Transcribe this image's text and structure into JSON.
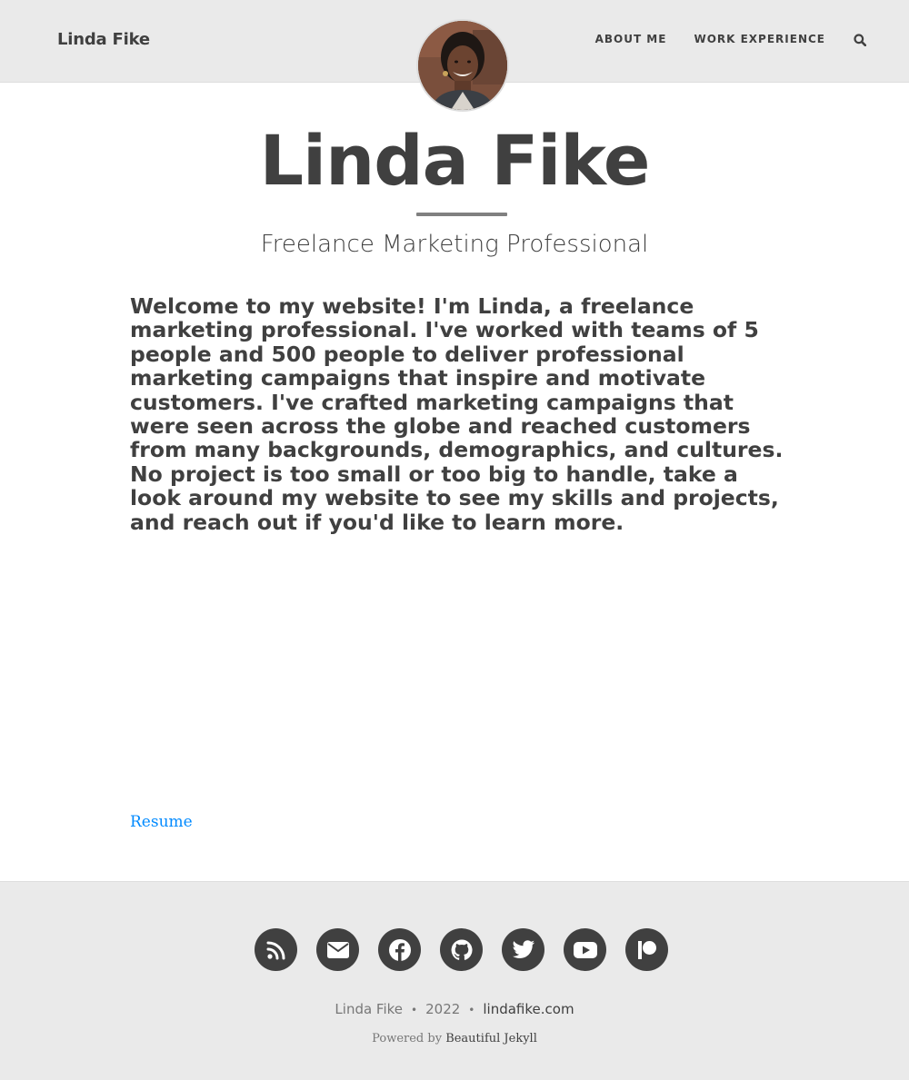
{
  "navbar": {
    "brand": "Linda Fike",
    "links": [
      "About Me",
      "Work Experience"
    ],
    "search_icon": "search-icon"
  },
  "avatar": {
    "icon": "avatar-photo"
  },
  "header": {
    "title": "Linda Fike",
    "subtitle": "Freelance Marketing Professional"
  },
  "main": {
    "intro": "Welcome to my website! I'm Linda, a freelance marketing professional. I've worked with teams of 5 people and 500 people to deliver professional marketing campaigns that inspire and motivate customers. I've crafted marketing campaigns that were seen across the globe and reached customers from many backgrounds, demographics, and cultures. No project is too small or too big to handle, take a look around my website to see my skills and projects, and reach out if you'd like to learn more.",
    "resume_link": "Resume"
  },
  "footer": {
    "social_icons": [
      "rss-icon",
      "email-icon",
      "facebook-icon",
      "github-icon",
      "twitter-icon",
      "youtube-icon",
      "patreon-icon"
    ],
    "author": "Linda Fike",
    "year": "2022",
    "site": "lindafike.com",
    "powered_prefix": "Powered by",
    "powered_link": "Beautiful Jekyll",
    "separator": "•"
  },
  "colors": {
    "nav_bg": "#eaeaea",
    "text": "#404040",
    "link": "#008AFF",
    "footer_bg": "#eaeaea"
  }
}
